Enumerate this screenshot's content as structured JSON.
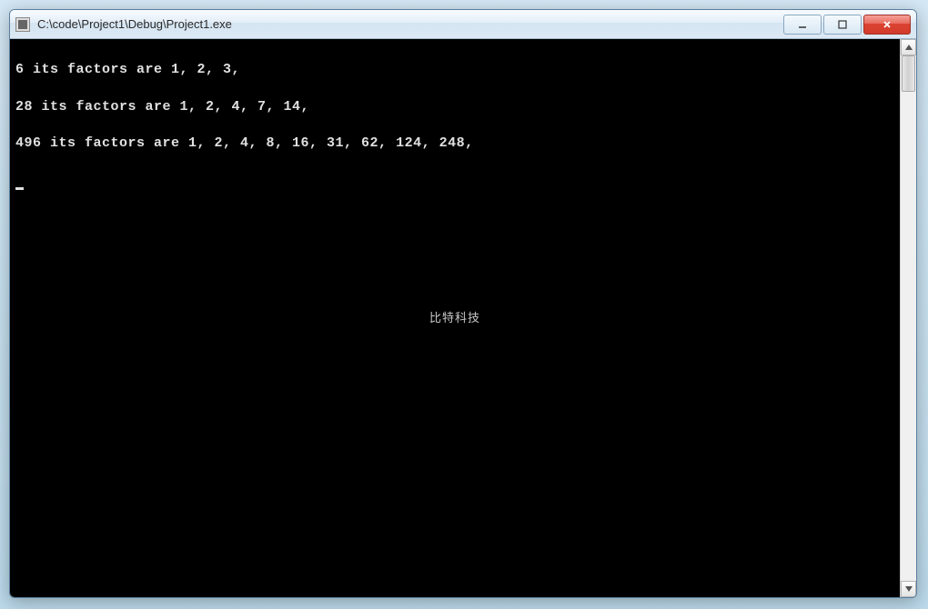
{
  "window": {
    "title": "C:\\code\\Project1\\Debug\\Project1.exe"
  },
  "console": {
    "lines": [
      "6 its factors are 1, 2, 3,",
      "28 its factors are 1, 2, 4, 7, 14,",
      "496 its factors are 1, 2, 4, 8, 16, 31, 62, 124, 248,"
    ],
    "watermark": "比特科技"
  },
  "controls": {
    "minimize": "minimize",
    "maximize": "maximize",
    "close": "close"
  }
}
